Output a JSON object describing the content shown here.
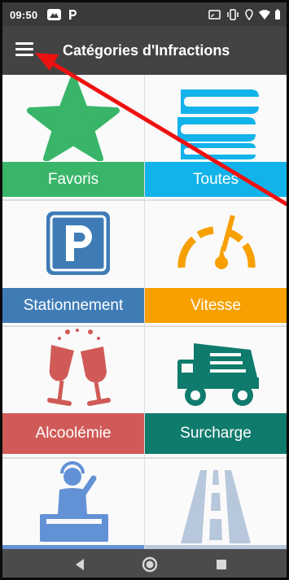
{
  "status_bar": {
    "time": "09:50"
  },
  "app_bar": {
    "title": "Catégories d'Infractions"
  },
  "categories": [
    {
      "label": "Favoris",
      "icon": "star-icon",
      "color": "#39b56a"
    },
    {
      "label": "Toutes",
      "icon": "books-icon",
      "color": "#12b3ea"
    },
    {
      "label": "Stationnement",
      "icon": "parking-icon",
      "color": "#3f7cb6"
    },
    {
      "label": "Vitesse",
      "icon": "speedometer-icon",
      "color": "#f7a000"
    },
    {
      "label": "Alcoolémie",
      "icon": "wine-glasses-icon",
      "color": "#d05a57"
    },
    {
      "label": "Surcharge",
      "icon": "dump-truck-icon",
      "color": "#0f7b6c"
    },
    {
      "label": "",
      "icon": "dj-icon",
      "color": "#6391d6"
    },
    {
      "label": "",
      "icon": "road-icon",
      "color": "#b7c7dc"
    }
  ],
  "annotation": {
    "color": "#ee1111"
  }
}
